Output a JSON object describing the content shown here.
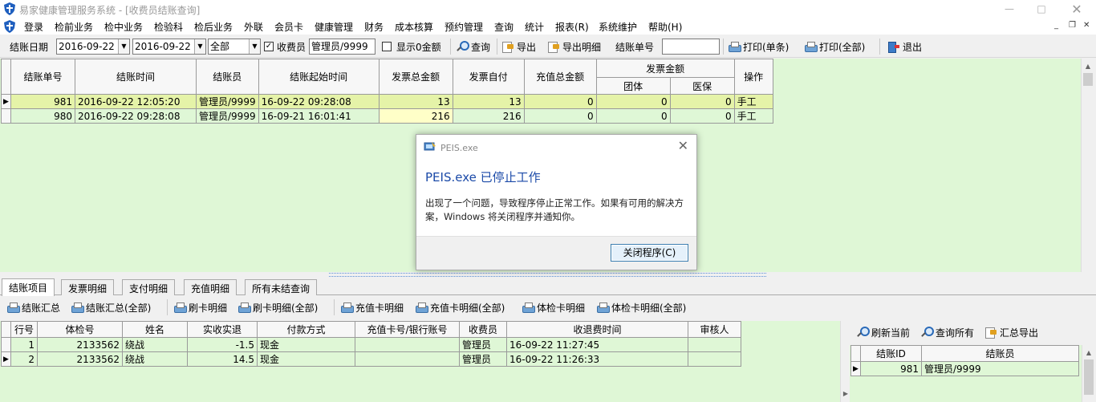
{
  "window": {
    "title": "易家健康管理服务系统 - [收费员结账查询]",
    "min": "—",
    "max": "□",
    "close": "✕"
  },
  "menu": {
    "items": [
      "登录",
      "检前业务",
      "检中业务",
      "检验科",
      "检后业务",
      "外联",
      "会员卡",
      "健康管理",
      "财务",
      "成本核算",
      "预约管理",
      "查询",
      "统计",
      "报表(R)",
      "系统维护",
      "帮助(H)"
    ],
    "mdi_min": "_",
    "mdi_restore": "❐",
    "mdi_close": "✕"
  },
  "toolbar": {
    "date_label": "结账日期",
    "date_from": "2016-09-22",
    "date_to": "2016-09-22",
    "scope": "全部",
    "cashier_label": "收费员",
    "cashier_value": "管理员/9999",
    "show_zero_label": "显示0金额",
    "query": "查询",
    "export": "导出",
    "export_detail": "导出明细",
    "bill_no_label": "结账单号",
    "bill_no_value": "",
    "print_single": "打印(单条)",
    "print_all": "打印(全部)",
    "exit": "退出"
  },
  "main_grid": {
    "headers": {
      "bill_no": "结账单号",
      "bill_time": "结账时间",
      "cashier": "结账员",
      "start_time": "结账起始时间",
      "invoice_total": "发票总金额",
      "invoice_self": "发票自付",
      "recharge_total": "充值总金额",
      "invoice_amount": "发票金额",
      "group": "团体",
      "insurance": "医保",
      "operation": "操作"
    },
    "rows": [
      {
        "indicator": "▶",
        "bill_no": "981",
        "bill_time": "2016-09-22 12:05:20",
        "cashier": "管理员/9999",
        "start_time": "16-09-22 09:28:08",
        "invoice_total": "13",
        "invoice_self": "13",
        "recharge_total": "0",
        "group": "0",
        "insurance": "0",
        "operation": "手工"
      },
      {
        "indicator": "",
        "bill_no": "980",
        "bill_time": "2016-09-22 09:28:08",
        "cashier": "管理员/9999",
        "start_time": "16-09-21 16:01:41",
        "invoice_total": "216",
        "invoice_self": "216",
        "recharge_total": "0",
        "group": "0",
        "insurance": "0",
        "operation": "手工"
      }
    ]
  },
  "tabs": [
    "结账项目",
    "发票明细",
    "支付明细",
    "充值明细",
    "所有未结查询"
  ],
  "bottom_toolbar": [
    "结账汇总",
    "结账汇总(全部)",
    "刷卡明细",
    "刷卡明细(全部)",
    "充值卡明细",
    "充值卡明细(全部)",
    "体检卡明细",
    "体检卡明细(全部)"
  ],
  "detail_grid": {
    "headers": [
      "行号",
      "体检号",
      "姓名",
      "实收实退",
      "付款方式",
      "充值卡号/银行账号",
      "收费员",
      "收退费时间",
      "审核人"
    ],
    "rows": [
      {
        "indicator": "",
        "line": "1",
        "exam_no": "2133562",
        "name": "绕战",
        "amount": "-1.5",
        "pay": "现金",
        "card": "",
        "cashier": "管理员",
        "time": "16-09-22 11:27:45",
        "auditor": ""
      },
      {
        "indicator": "▶",
        "line": "2",
        "exam_no": "2133562",
        "name": "绕战",
        "amount": "14.5",
        "pay": "现金",
        "card": "",
        "cashier": "管理员",
        "time": "16-09-22 11:26:33",
        "auditor": ""
      }
    ]
  },
  "right_panel": {
    "refresh": "刷新当前",
    "query_all": "查询所有",
    "summary_export": "汇总导出",
    "headers": [
      "结账ID",
      "结账员"
    ],
    "rows": [
      {
        "indicator": "▶",
        "id": "981",
        "cashier": "管理员/9999"
      }
    ]
  },
  "dialog": {
    "title": "PEIS.exe",
    "heading": "PEIS.exe 已停止工作",
    "message": "出现了一个问题，导致程序停止正常工作。如果有可用的解决方案，Windows 将关闭程序并通知你。",
    "button": "关闭程序(C)",
    "close": "✕"
  }
}
